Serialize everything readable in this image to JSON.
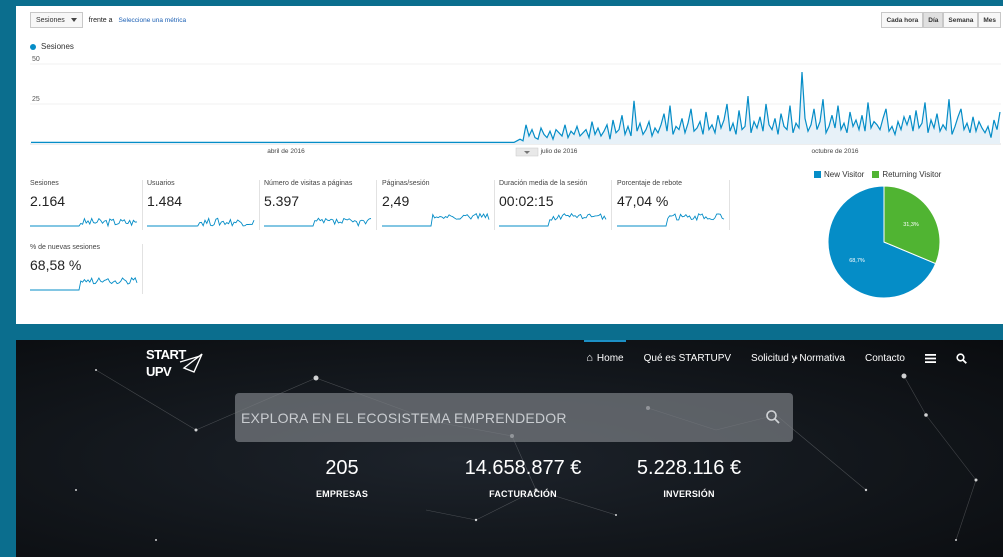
{
  "toolbar": {
    "metric_label": "Sesiones",
    "vs_label": "frente a",
    "select_metric": "Seleccione una métrica",
    "granularity": [
      "Cada hora",
      "Día",
      "Semana",
      "Mes"
    ],
    "granularity_active": "Día"
  },
  "chart_data": {
    "type": "area",
    "title": "",
    "series": [
      {
        "name": "Sesiones",
        "color": "#058dc7",
        "values": [
          1,
          1,
          1,
          1,
          1,
          1,
          1,
          1,
          1,
          1,
          1,
          1,
          1,
          1,
          1,
          1,
          1,
          1,
          1,
          1,
          1,
          1,
          1,
          1,
          1,
          1,
          1,
          1,
          1,
          1,
          1,
          1,
          1,
          1,
          1,
          1,
          1,
          1,
          1,
          1,
          1,
          1,
          1,
          1,
          1,
          1,
          1,
          1,
          1,
          1,
          1,
          1,
          1,
          1,
          1,
          1,
          1,
          1,
          1,
          1,
          1,
          1,
          1,
          1,
          1,
          1,
          1,
          1,
          1,
          1,
          1,
          1,
          1,
          1,
          1,
          1,
          1,
          1,
          1,
          1,
          1,
          1,
          1,
          1,
          1,
          1,
          1,
          1,
          1,
          1,
          1,
          1,
          1,
          1,
          1,
          1,
          1,
          1,
          1,
          1,
          1,
          1,
          1,
          1,
          1,
          1,
          1,
          1,
          1,
          1,
          1,
          1,
          1,
          1,
          1,
          1,
          1,
          1,
          1,
          1,
          1,
          1,
          1,
          1,
          1,
          1,
          1,
          1,
          1,
          1,
          1,
          1,
          1,
          1,
          1,
          1,
          1,
          1,
          1,
          1,
          1,
          1,
          1,
          1,
          1,
          1,
          1,
          1,
          1,
          1,
          1,
          1,
          1,
          1,
          1,
          1,
          1,
          1,
          1,
          1,
          1,
          1,
          2,
          3,
          2,
          12,
          5,
          9,
          4,
          3,
          10,
          6,
          4,
          8,
          3,
          9,
          7,
          5,
          12,
          4,
          8,
          6,
          11,
          5,
          7,
          9,
          4,
          14,
          6,
          10,
          5,
          8,
          12,
          3,
          15,
          7,
          9,
          18,
          6,
          11,
          5,
          27,
          8,
          13,
          6,
          9,
          14,
          5,
          10,
          7,
          12,
          19,
          8,
          24,
          6,
          11,
          9,
          16,
          7,
          13,
          22,
          8,
          10,
          14,
          6,
          20,
          9,
          12,
          7,
          18,
          10,
          15,
          25,
          8,
          13,
          6,
          21,
          9,
          11,
          30,
          7,
          14,
          10,
          17,
          8,
          25,
          12,
          9,
          16,
          6,
          19,
          11,
          9,
          24,
          7,
          13,
          10,
          45,
          16,
          8,
          12,
          22,
          9,
          14,
          28,
          7,
          11,
          18,
          10,
          24,
          9,
          13,
          7,
          20,
          11,
          15,
          9,
          18,
          8,
          26,
          10,
          14,
          12,
          9,
          16,
          22,
          8,
          11,
          6,
          14,
          9,
          17,
          12,
          18,
          8,
          21,
          10,
          13,
          26,
          7,
          15,
          10,
          19,
          8,
          12,
          9,
          28,
          6,
          11,
          17,
          22,
          9,
          13,
          7,
          17,
          8,
          14,
          10,
          7,
          11,
          4,
          15,
          9,
          20
        ],
        "fill_color": "#e7f1f8"
      }
    ],
    "ylim": [
      0,
      55
    ],
    "yticks": [
      50,
      25
    ],
    "x_tick_labels": [
      {
        "label": "abril de 2016",
        "index": 85
      },
      {
        "label": "julio de 2016",
        "index": 176
      },
      {
        "label": "octubre de 2016",
        "index": 268
      }
    ],
    "grid": true
  },
  "metrics": [
    {
      "label": "Sesiones",
      "value": "2.164"
    },
    {
      "label": "Usuarios",
      "value": "1.484"
    },
    {
      "label": "Número de visitas a páginas",
      "value": "5.397"
    },
    {
      "label": "Páginas/sesión",
      "value": "2,49"
    },
    {
      "label": "Duración media de la sesión",
      "value": "00:02:15"
    },
    {
      "label": "Porcentaje de rebote",
      "value": "47,04 %"
    },
    {
      "label": "% de nuevas sesiones",
      "value": "68,58 %"
    }
  ],
  "pie": {
    "legend": [
      {
        "label": "New Visitor",
        "color": "#058dc7",
        "value": 68.7,
        "value_label": "68,7%"
      },
      {
        "label": "Returning Visitor",
        "color": "#50b432",
        "value": 31.3,
        "value_label": "31,3%"
      }
    ]
  },
  "site": {
    "logo_text_top": "START",
    "logo_text_bottom": "UPV",
    "nav": [
      {
        "label": "Home",
        "active": true,
        "icon": "home-icon"
      },
      {
        "label": "Qué es STARTUPV",
        "active": false
      },
      {
        "label": "Solicitud y Normativa",
        "active": false
      },
      {
        "label": "Contacto",
        "active": false
      }
    ],
    "search_placeholder": "EXPLORA EN EL ECOSISTEMA EMPRENDEDOR",
    "stats": [
      {
        "value": "205",
        "label": "EMPRESAS"
      },
      {
        "value": "14.658.877 €",
        "label": "FACTURACIÓN"
      },
      {
        "value": "5.228.116 €",
        "label": "INVERSIÓN"
      }
    ],
    "accent": "#1c8fc4"
  }
}
